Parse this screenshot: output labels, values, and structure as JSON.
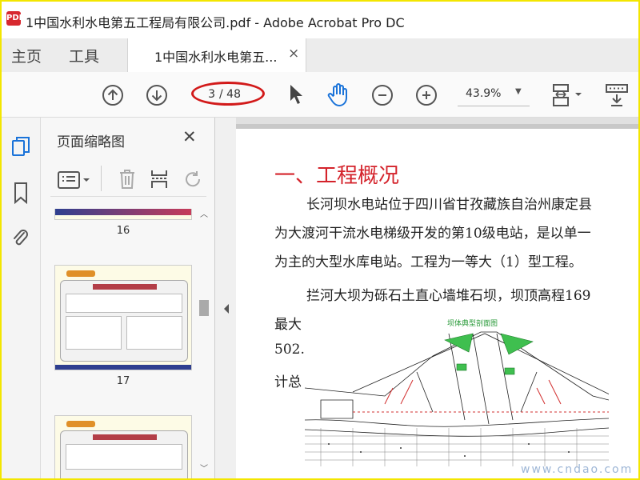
{
  "window": {
    "icon_text": "PDF",
    "title": "1中国水利水电第五工程局有限公司.pdf - Adobe Acrobat Pro DC"
  },
  "tabs": {
    "home": "主页",
    "tools": "工具",
    "document": "1中国水利水电第五...",
    "close": "×"
  },
  "toolbar": {
    "page_current": "3",
    "page_total": "/ 48",
    "zoom": "43.9%"
  },
  "thumbnail_pane": {
    "title": "页面缩略图",
    "close": "✕",
    "thumbs": [
      {
        "page": "16"
      },
      {
        "page": "17"
      }
    ]
  },
  "document": {
    "heading": "一、工程概况",
    "lines": [
      "长河坝水电站位于四川省甘孜藏族自治州康定县",
      "为大渡河干流水电梯级开发的第10级电站，是以单一",
      "为主的大型水库电站。工程为一等大（1）型工程。",
      "拦河大坝为砾石土直心墙堆石坝，坝顶高程169",
      "最大",
      "502.",
      "计总"
    ],
    "diagram_title": "坝体典型剖面图"
  },
  "watermark": "www.cndao.com",
  "colors": {
    "heading": "#d4232b",
    "annotation": "#d21a1a",
    "hand_tool": "#1a73d9",
    "frame": "#f3e600"
  }
}
